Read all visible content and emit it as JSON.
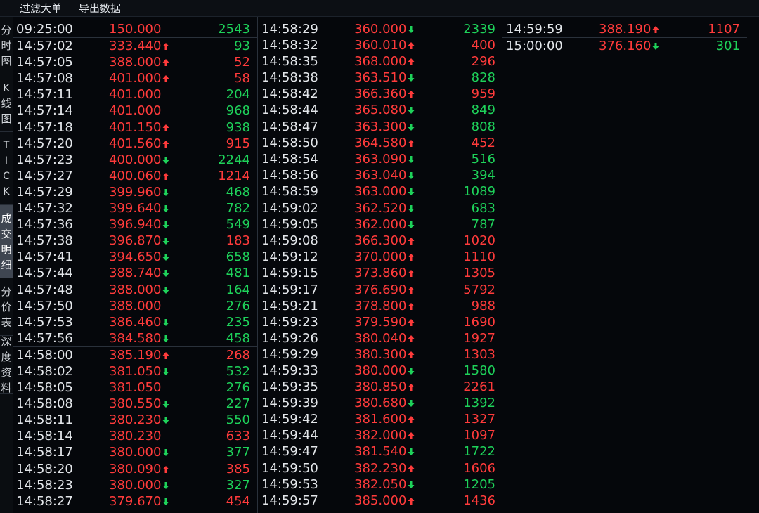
{
  "toolbar": {
    "filter_label": "过滤大单",
    "export_label": "导出数据"
  },
  "sidebar": {
    "tabs": [
      {
        "chars": [
          "分",
          "时",
          "图"
        ],
        "active": false
      },
      {
        "chars": [
          "K",
          "线",
          "图"
        ],
        "active": false
      },
      {
        "chars": [
          "T",
          "I",
          "C",
          "K"
        ],
        "active": false
      },
      {
        "chars": [
          "成",
          "交",
          "明",
          "细"
        ],
        "active": true
      },
      {
        "chars": [
          "分",
          "价",
          "表"
        ],
        "active": false
      },
      {
        "chars": [
          "深",
          "度",
          "资",
          "料"
        ],
        "active": false
      }
    ]
  },
  "colors": {
    "up": "#ff3b3b",
    "down": "#1ed25a",
    "background": "#05070b"
  },
  "columns": [
    [
      {
        "time": "09:25:00",
        "price": "150.000",
        "dir": "",
        "vol": "2543",
        "vol_color": "green"
      },
      {
        "time": "14:57:02",
        "price": "333.440",
        "dir": "up",
        "vol": "93",
        "vol_color": "green",
        "sep": true
      },
      {
        "time": "14:57:05",
        "price": "388.000",
        "dir": "up",
        "vol": "52",
        "vol_color": "red"
      },
      {
        "time": "14:57:08",
        "price": "401.000",
        "dir": "up",
        "vol": "58",
        "vol_color": "red"
      },
      {
        "time": "14:57:11",
        "price": "401.000",
        "dir": "",
        "vol": "204",
        "vol_color": "green"
      },
      {
        "time": "14:57:14",
        "price": "401.000",
        "dir": "",
        "vol": "968",
        "vol_color": "green"
      },
      {
        "time": "14:57:18",
        "price": "401.150",
        "dir": "up",
        "vol": "938",
        "vol_color": "green"
      },
      {
        "time": "14:57:20",
        "price": "401.560",
        "dir": "up",
        "vol": "915",
        "vol_color": "red"
      },
      {
        "time": "14:57:23",
        "price": "400.000",
        "dir": "down",
        "vol": "2244",
        "vol_color": "green"
      },
      {
        "time": "14:57:27",
        "price": "400.060",
        "dir": "up",
        "vol": "1214",
        "vol_color": "red"
      },
      {
        "time": "14:57:29",
        "price": "399.960",
        "dir": "down",
        "vol": "468",
        "vol_color": "green"
      },
      {
        "time": "14:57:32",
        "price": "399.640",
        "dir": "down",
        "vol": "782",
        "vol_color": "green"
      },
      {
        "time": "14:57:36",
        "price": "396.940",
        "dir": "down",
        "vol": "549",
        "vol_color": "green"
      },
      {
        "time": "14:57:38",
        "price": "396.870",
        "dir": "down",
        "vol": "183",
        "vol_color": "red"
      },
      {
        "time": "14:57:41",
        "price": "394.650",
        "dir": "down",
        "vol": "658",
        "vol_color": "green"
      },
      {
        "time": "14:57:44",
        "price": "388.740",
        "dir": "down",
        "vol": "481",
        "vol_color": "green"
      },
      {
        "time": "14:57:48",
        "price": "388.000",
        "dir": "down",
        "vol": "164",
        "vol_color": "green"
      },
      {
        "time": "14:57:50",
        "price": "388.000",
        "dir": "",
        "vol": "276",
        "vol_color": "green"
      },
      {
        "time": "14:57:53",
        "price": "386.460",
        "dir": "down",
        "vol": "235",
        "vol_color": "green"
      },
      {
        "time": "14:57:56",
        "price": "384.580",
        "dir": "down",
        "vol": "458",
        "vol_color": "green"
      },
      {
        "time": "14:58:00",
        "price": "385.190",
        "dir": "up",
        "vol": "268",
        "vol_color": "red",
        "sep": true
      },
      {
        "time": "14:58:02",
        "price": "381.050",
        "dir": "down",
        "vol": "532",
        "vol_color": "green"
      },
      {
        "time": "14:58:05",
        "price": "381.050",
        "dir": "",
        "vol": "276",
        "vol_color": "green"
      },
      {
        "time": "14:58:08",
        "price": "380.550",
        "dir": "down",
        "vol": "227",
        "vol_color": "green"
      },
      {
        "time": "14:58:11",
        "price": "380.230",
        "dir": "down",
        "vol": "550",
        "vol_color": "green"
      },
      {
        "time": "14:58:14",
        "price": "380.230",
        "dir": "",
        "vol": "633",
        "vol_color": "red"
      },
      {
        "time": "14:58:17",
        "price": "380.000",
        "dir": "down",
        "vol": "377",
        "vol_color": "green"
      },
      {
        "time": "14:58:20",
        "price": "380.090",
        "dir": "up",
        "vol": "385",
        "vol_color": "red"
      },
      {
        "time": "14:58:23",
        "price": "380.000",
        "dir": "down",
        "vol": "327",
        "vol_color": "green"
      },
      {
        "time": "14:58:27",
        "price": "379.670",
        "dir": "down",
        "vol": "454",
        "vol_color": "red"
      }
    ],
    [
      {
        "time": "14:58:29",
        "price": "360.000",
        "dir": "down",
        "vol": "2339",
        "vol_color": "green"
      },
      {
        "time": "14:58:32",
        "price": "360.010",
        "dir": "up",
        "vol": "400",
        "vol_color": "red"
      },
      {
        "time": "14:58:35",
        "price": "368.000",
        "dir": "up",
        "vol": "296",
        "vol_color": "red"
      },
      {
        "time": "14:58:38",
        "price": "363.510",
        "dir": "down",
        "vol": "828",
        "vol_color": "green"
      },
      {
        "time": "14:58:42",
        "price": "366.360",
        "dir": "up",
        "vol": "959",
        "vol_color": "red"
      },
      {
        "time": "14:58:44",
        "price": "365.080",
        "dir": "down",
        "vol": "849",
        "vol_color": "green"
      },
      {
        "time": "14:58:47",
        "price": "363.300",
        "dir": "down",
        "vol": "808",
        "vol_color": "green"
      },
      {
        "time": "14:58:50",
        "price": "364.580",
        "dir": "up",
        "vol": "452",
        "vol_color": "red"
      },
      {
        "time": "14:58:54",
        "price": "363.090",
        "dir": "down",
        "vol": "516",
        "vol_color": "green"
      },
      {
        "time": "14:58:56",
        "price": "363.040",
        "dir": "down",
        "vol": "394",
        "vol_color": "green"
      },
      {
        "time": "14:58:59",
        "price": "363.000",
        "dir": "down",
        "vol": "1089",
        "vol_color": "green"
      },
      {
        "time": "14:59:02",
        "price": "362.520",
        "dir": "down",
        "vol": "683",
        "vol_color": "green",
        "sep": true
      },
      {
        "time": "14:59:05",
        "price": "362.000",
        "dir": "down",
        "vol": "787",
        "vol_color": "green"
      },
      {
        "time": "14:59:08",
        "price": "366.300",
        "dir": "up",
        "vol": "1020",
        "vol_color": "red"
      },
      {
        "time": "14:59:12",
        "price": "370.000",
        "dir": "up",
        "vol": "1110",
        "vol_color": "red"
      },
      {
        "time": "14:59:15",
        "price": "373.860",
        "dir": "up",
        "vol": "1305",
        "vol_color": "red"
      },
      {
        "time": "14:59:17",
        "price": "376.690",
        "dir": "up",
        "vol": "5792",
        "vol_color": "red"
      },
      {
        "time": "14:59:21",
        "price": "378.800",
        "dir": "up",
        "vol": "988",
        "vol_color": "red"
      },
      {
        "time": "14:59:23",
        "price": "379.590",
        "dir": "up",
        "vol": "1690",
        "vol_color": "red"
      },
      {
        "time": "14:59:26",
        "price": "380.040",
        "dir": "up",
        "vol": "1927",
        "vol_color": "red"
      },
      {
        "time": "14:59:29",
        "price": "380.300",
        "dir": "up",
        "vol": "1303",
        "vol_color": "red"
      },
      {
        "time": "14:59:33",
        "price": "380.000",
        "dir": "down",
        "vol": "1580",
        "vol_color": "green"
      },
      {
        "time": "14:59:35",
        "price": "380.850",
        "dir": "up",
        "vol": "2261",
        "vol_color": "red"
      },
      {
        "time": "14:59:39",
        "price": "380.680",
        "dir": "down",
        "vol": "1392",
        "vol_color": "green"
      },
      {
        "time": "14:59:42",
        "price": "381.600",
        "dir": "up",
        "vol": "1327",
        "vol_color": "red"
      },
      {
        "time": "14:59:44",
        "price": "382.000",
        "dir": "up",
        "vol": "1097",
        "vol_color": "red"
      },
      {
        "time": "14:59:47",
        "price": "381.540",
        "dir": "down",
        "vol": "1722",
        "vol_color": "green"
      },
      {
        "time": "14:59:50",
        "price": "382.230",
        "dir": "up",
        "vol": "1606",
        "vol_color": "red"
      },
      {
        "time": "14:59:53",
        "price": "382.050",
        "dir": "down",
        "vol": "1205",
        "vol_color": "green"
      },
      {
        "time": "14:59:57",
        "price": "385.000",
        "dir": "up",
        "vol": "1436",
        "vol_color": "red"
      }
    ],
    [
      {
        "time": "14:59:59",
        "price": "388.190",
        "dir": "up",
        "vol": "1107",
        "vol_color": "red"
      },
      {
        "time": "15:00:00",
        "price": "376.160",
        "dir": "down",
        "vol": "301",
        "vol_color": "green",
        "sep": true
      }
    ]
  ]
}
